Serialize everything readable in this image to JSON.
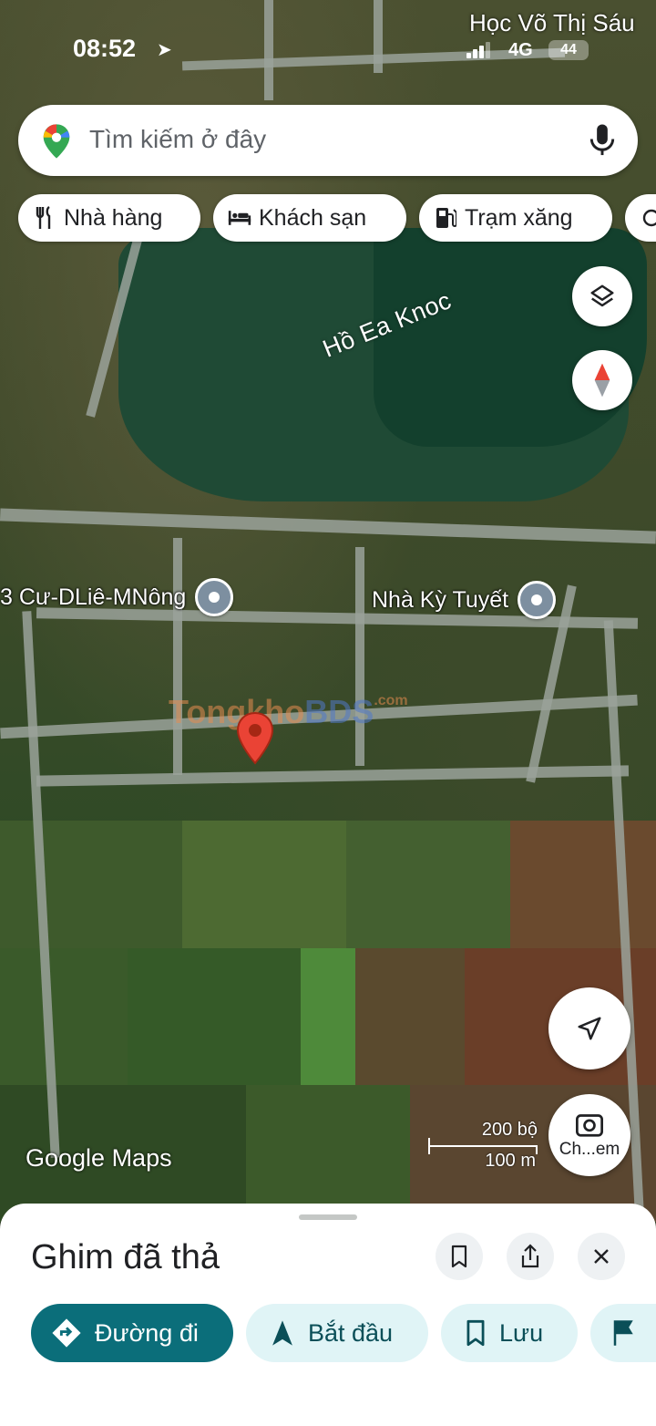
{
  "status": {
    "time": "08:52",
    "network": "4G",
    "battery": "44",
    "top_label": "Học Võ Thị Sáu"
  },
  "search": {
    "placeholder": "Tìm kiếm ở đây"
  },
  "chips": [
    "Nhà hàng",
    "Khách sạn",
    "Trạm xăng"
  ],
  "map": {
    "lake_label": "Hồ Ea Knoc",
    "places": [
      "3 Cư-DLiê-MNông",
      "Nhà Kỳ Tuyết"
    ],
    "watermark": {
      "part1": "Tongkho",
      "part2": "BDS",
      "suffix": ".com"
    },
    "logo": "Google Maps",
    "scale_top": "200 bộ",
    "scale_bottom": "100 m",
    "camera_label": "Ch...em"
  },
  "sheet": {
    "title": "Ghim đã thả",
    "actions": [
      "Đường đi",
      "Bắt đầu",
      "Lưu"
    ]
  },
  "colors": {
    "primary": "#0b6e7a",
    "chip_bg": "#e0f4f6",
    "pin": "#ea4335"
  }
}
